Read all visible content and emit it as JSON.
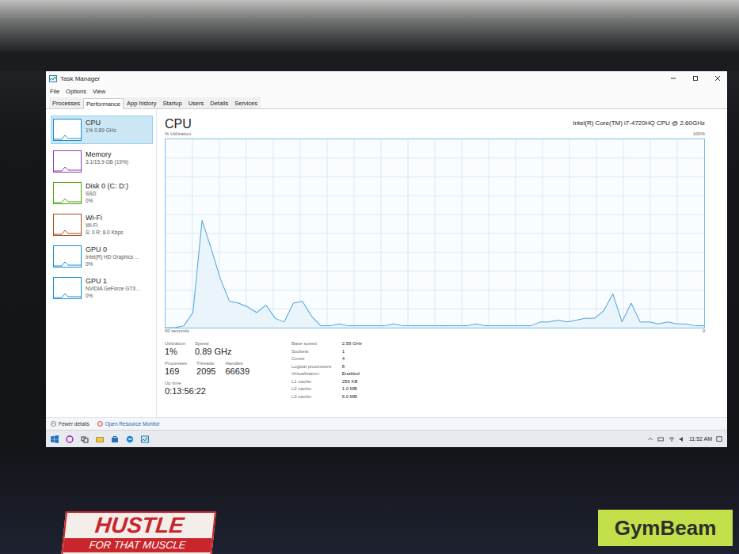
{
  "window": {
    "title": "Task Manager"
  },
  "menu": [
    "File",
    "Options",
    "View"
  ],
  "tabs": [
    {
      "label": "Processes",
      "selected": false
    },
    {
      "label": "Performance",
      "selected": true
    },
    {
      "label": "App history",
      "selected": false
    },
    {
      "label": "Startup",
      "selected": false
    },
    {
      "label": "Users",
      "selected": false
    },
    {
      "label": "Details",
      "selected": false
    },
    {
      "label": "Services",
      "selected": false
    }
  ],
  "sidebar": {
    "items": [
      {
        "name": "CPU",
        "lines": [
          "1% 0.89 GHz"
        ],
        "selected": true,
        "color": "#1b8ed6"
      },
      {
        "name": "Memory",
        "lines": [
          "3.1/15.9 GB (19%)"
        ],
        "selected": false,
        "color": "#8b3fb0"
      },
      {
        "name": "Disk 0 (C: D:)",
        "lines": [
          "SSD",
          "0%"
        ],
        "selected": false,
        "color": "#4da60c"
      },
      {
        "name": "Wi-Fi",
        "lines": [
          "Wi-Fi",
          "S: 0 R: 8.0 Kbps"
        ],
        "selected": false,
        "color": "#a74f1b"
      },
      {
        "name": "GPU 0",
        "lines": [
          "Intel(R) HD Graphics ...",
          "0%"
        ],
        "selected": false,
        "color": "#1b8ed6"
      },
      {
        "name": "GPU 1",
        "lines": [
          "NVIDIA GeForce GTX...",
          "0%"
        ],
        "selected": false,
        "color": "#1b8ed6"
      }
    ]
  },
  "main": {
    "title": "CPU",
    "model": "Intel(R) Core(TM) i7-4720HQ CPU @ 2.60GHz"
  },
  "chart": {
    "axis_label": "% Utilization",
    "max_label": "100%",
    "time_label": "60 seconds",
    "min_label": "0",
    "max": 100,
    "values": [
      0,
      0,
      1,
      8,
      57,
      42,
      26,
      14,
      13,
      11,
      8,
      12,
      5,
      3,
      13,
      14,
      6,
      1,
      1,
      2,
      1,
      1,
      1,
      1,
      1,
      2,
      1,
      1,
      1,
      1,
      1,
      1,
      1,
      1,
      2,
      1,
      1,
      1,
      1,
      1,
      1,
      3,
      3,
      4,
      3,
      4,
      5,
      5,
      9,
      18,
      3,
      13,
      3,
      3,
      2,
      3,
      2,
      2,
      1,
      1
    ]
  },
  "stat_rows": [
    [
      {
        "label": "Utilization",
        "value": "1%"
      },
      {
        "label": "Speed",
        "value": "0.89 GHz"
      }
    ],
    [
      {
        "label": "Processes",
        "value": "169"
      },
      {
        "label": "Threads",
        "value": "2095"
      },
      {
        "label": "Handles",
        "value": "66639"
      }
    ],
    [
      {
        "label": "Up time",
        "value": "0:13:56:22"
      }
    ]
  ],
  "details": [
    {
      "label": "Base speed:",
      "value": "2.59 GHz"
    },
    {
      "label": "Sockets:",
      "value": "1"
    },
    {
      "label": "Cores:",
      "value": "4"
    },
    {
      "label": "Logical processors:",
      "value": "8"
    },
    {
      "label": "Virtualization:",
      "value": "Enabled"
    },
    {
      "label": "L1 cache:",
      "value": "256 KB"
    },
    {
      "label": "L2 cache:",
      "value": "1.0 MB"
    },
    {
      "label": "L3 cache:",
      "value": "6.0 MB"
    }
  ],
  "footer": {
    "fewer_details": "Fewer details",
    "resource_monitor": "Open Resource Monitor"
  },
  "taskbar": {
    "time": "11:52 AM"
  },
  "stickers": [
    {
      "lines": [
        "HUSTLE",
        "FOR THAT MUSCLE"
      ],
      "color": "#c8262c"
    },
    {
      "lines": [
        "GymBeam"
      ],
      "color": "#c3e04a"
    }
  ]
}
